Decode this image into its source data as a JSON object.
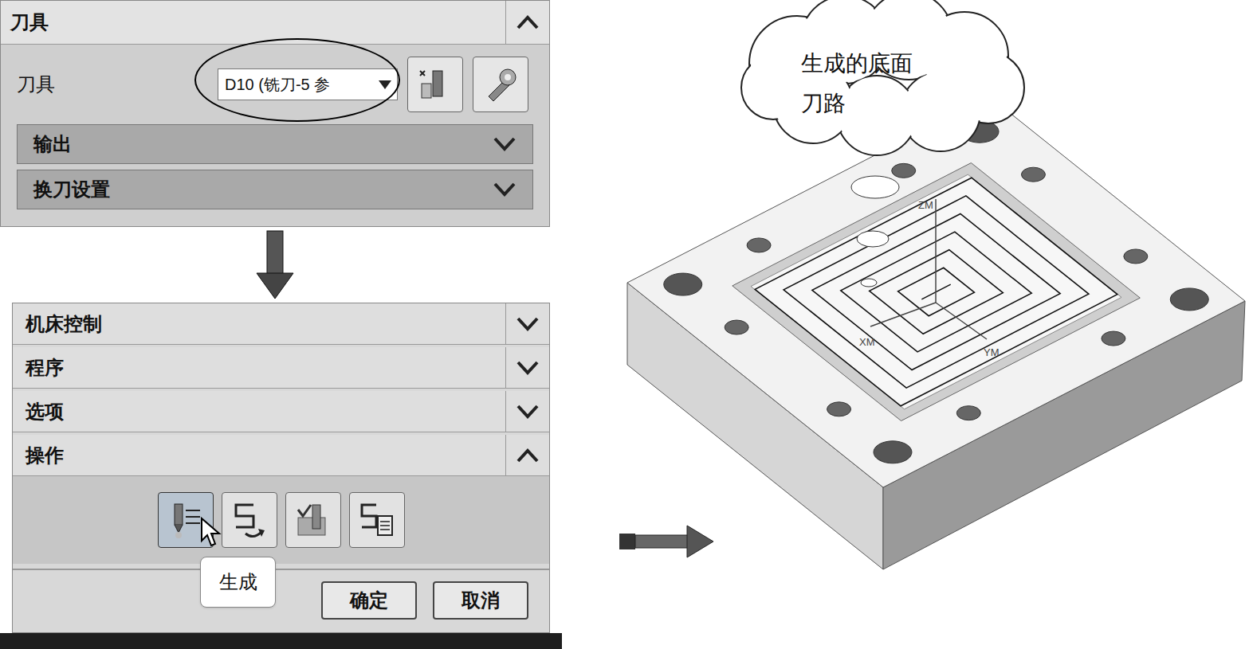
{
  "tool_group": {
    "title": "刀具",
    "expanded": true,
    "tool_label": "刀具",
    "tool_value": "D10 (铣刀-5 参",
    "subsections": [
      {
        "label": "输出",
        "expanded": false
      },
      {
        "label": "换刀设置",
        "expanded": false
      }
    ]
  },
  "dialog": {
    "sections": [
      {
        "label": "机床控制",
        "expanded": false
      },
      {
        "label": "程序",
        "expanded": false
      },
      {
        "label": "选项",
        "expanded": false
      },
      {
        "label": "操作",
        "expanded": true
      }
    ],
    "actions": [
      {
        "kind": "generate",
        "hovered": true
      },
      {
        "kind": "replay",
        "hovered": false
      },
      {
        "kind": "verify",
        "hovered": false
      },
      {
        "kind": "list",
        "hovered": false
      }
    ],
    "tooltip": "生成",
    "buttons": [
      "确定",
      "取消"
    ]
  },
  "model_view": {
    "callout": [
      "生成的底面",
      "刀路"
    ],
    "axes": [
      {
        "label": "ZM"
      },
      {
        "label": "XM"
      },
      {
        "label": "YM"
      }
    ]
  }
}
